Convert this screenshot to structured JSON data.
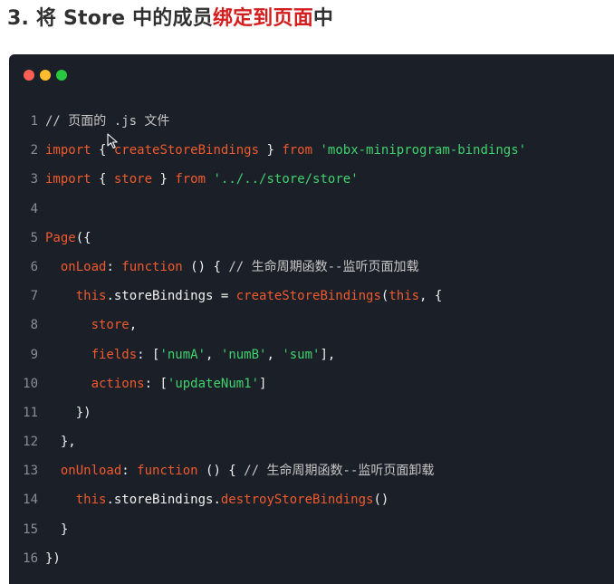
{
  "heading": {
    "prefix": "3. 将 Store 中的成员",
    "highlight": "绑定到页面",
    "suffix": "中"
  },
  "colors": {
    "heading_highlight": "#d41d1d",
    "window_bg": "#1b1f27",
    "dot_close": "#fe5f57",
    "dot_minimize": "#febc2e",
    "dot_maximize": "#28c840",
    "keyword": "#ef5a2e",
    "string": "#3fd36f",
    "comment": "#c7c7c7",
    "plain": "#f2f2f2",
    "line_number": "#8a8e96"
  },
  "window_dots": [
    "close-dot",
    "minimize-dot",
    "maximize-dot"
  ],
  "icons": {
    "cursor": "mouse-pointer-icon"
  },
  "code_lines": [
    {
      "n": "1",
      "tokens": [
        {
          "t": "// 页面的 .js 文件",
          "c": "cm"
        }
      ]
    },
    {
      "n": "2",
      "tokens": [
        {
          "t": "import",
          "c": "kw"
        },
        {
          "t": " { ",
          "c": "pl"
        },
        {
          "t": "createStoreBindings",
          "c": "kw"
        },
        {
          "t": " } ",
          "c": "pl"
        },
        {
          "t": "from",
          "c": "kw"
        },
        {
          "t": " ",
          "c": "pl"
        },
        {
          "t": "'mobx-miniprogram-bindings'",
          "c": "str"
        }
      ]
    },
    {
      "n": "3",
      "tokens": [
        {
          "t": "import",
          "c": "kw"
        },
        {
          "t": " { ",
          "c": "pl"
        },
        {
          "t": "store",
          "c": "kw"
        },
        {
          "t": " } ",
          "c": "pl"
        },
        {
          "t": "from",
          "c": "kw"
        },
        {
          "t": " ",
          "c": "pl"
        },
        {
          "t": "'../../store/store'",
          "c": "str"
        }
      ]
    },
    {
      "n": "4",
      "tokens": []
    },
    {
      "n": "5",
      "tokens": [
        {
          "t": "Page",
          "c": "kw"
        },
        {
          "t": "({",
          "c": "pl"
        }
      ]
    },
    {
      "n": "6",
      "tokens": [
        {
          "t": "  ",
          "c": "pl"
        },
        {
          "t": "onLoad",
          "c": "kw"
        },
        {
          "t": ": ",
          "c": "pl"
        },
        {
          "t": "function",
          "c": "kw"
        },
        {
          "t": " () { ",
          "c": "pl"
        },
        {
          "t": "// 生命周期函数--监听页面加载",
          "c": "cm"
        }
      ]
    },
    {
      "n": "7",
      "tokens": [
        {
          "t": "    ",
          "c": "pl"
        },
        {
          "t": "this",
          "c": "kw"
        },
        {
          "t": ".storeBindings = ",
          "c": "pl"
        },
        {
          "t": "createStoreBindings",
          "c": "kw"
        },
        {
          "t": "(",
          "c": "pl"
        },
        {
          "t": "this",
          "c": "kw"
        },
        {
          "t": ", {",
          "c": "pl"
        }
      ]
    },
    {
      "n": "8",
      "tokens": [
        {
          "t": "      ",
          "c": "pl"
        },
        {
          "t": "store",
          "c": "kw"
        },
        {
          "t": ",",
          "c": "pl"
        }
      ]
    },
    {
      "n": "9",
      "tokens": [
        {
          "t": "      ",
          "c": "pl"
        },
        {
          "t": "fields",
          "c": "kw"
        },
        {
          "t": ": [",
          "c": "pl"
        },
        {
          "t": "'numA'",
          "c": "str"
        },
        {
          "t": ", ",
          "c": "pl"
        },
        {
          "t": "'numB'",
          "c": "str"
        },
        {
          "t": ", ",
          "c": "pl"
        },
        {
          "t": "'sum'",
          "c": "str"
        },
        {
          "t": "],",
          "c": "pl"
        }
      ]
    },
    {
      "n": "10",
      "tokens": [
        {
          "t": "      ",
          "c": "pl"
        },
        {
          "t": "actions",
          "c": "kw"
        },
        {
          "t": ": [",
          "c": "pl"
        },
        {
          "t": "'updateNum1'",
          "c": "str"
        },
        {
          "t": "]",
          "c": "pl"
        }
      ]
    },
    {
      "n": "11",
      "tokens": [
        {
          "t": "    })",
          "c": "pl"
        }
      ]
    },
    {
      "n": "12",
      "tokens": [
        {
          "t": "  },",
          "c": "pl"
        }
      ]
    },
    {
      "n": "13",
      "tokens": [
        {
          "t": "  ",
          "c": "pl"
        },
        {
          "t": "onUnload",
          "c": "kw"
        },
        {
          "t": ": ",
          "c": "pl"
        },
        {
          "t": "function",
          "c": "kw"
        },
        {
          "t": " () { ",
          "c": "pl"
        },
        {
          "t": "// 生命周期函数--监听页面卸载",
          "c": "cm"
        }
      ]
    },
    {
      "n": "14",
      "tokens": [
        {
          "t": "    ",
          "c": "pl"
        },
        {
          "t": "this",
          "c": "kw"
        },
        {
          "t": ".storeBindings.",
          "c": "pl"
        },
        {
          "t": "destroyStoreBindings",
          "c": "kw"
        },
        {
          "t": "()",
          "c": "pl"
        }
      ]
    },
    {
      "n": "15",
      "tokens": [
        {
          "t": "  }",
          "c": "pl"
        }
      ]
    },
    {
      "n": "16",
      "tokens": [
        {
          "t": "})",
          "c": "pl"
        }
      ]
    }
  ]
}
